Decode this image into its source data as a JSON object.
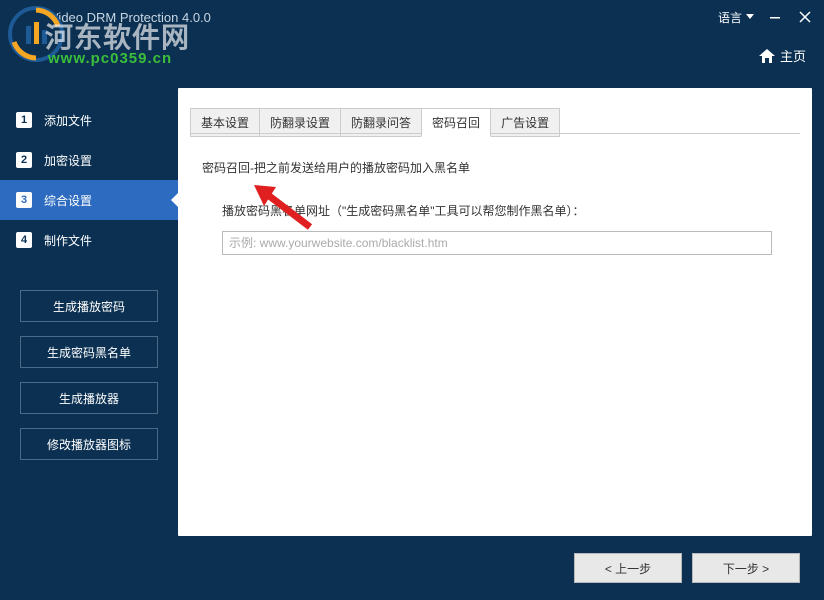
{
  "titlebar": {
    "app_title": "Video DRM Protection 4.0.0",
    "language_label": "语言"
  },
  "watermark": {
    "text": "河东软件网",
    "url": "www.pc0359.cn"
  },
  "breadcrumb": {
    "home": "主页"
  },
  "sidebar": {
    "steps": [
      {
        "num": "1",
        "label": "添加文件"
      },
      {
        "num": "2",
        "label": "加密设置"
      },
      {
        "num": "3",
        "label": "综合设置"
      },
      {
        "num": "4",
        "label": "制作文件"
      }
    ],
    "buttons": {
      "gen_password": "生成播放密码",
      "gen_blacklist": "生成密码黑名单",
      "gen_player": "生成播放器",
      "edit_player_icon": "修改播放器图标"
    }
  },
  "tabs": {
    "basic": "基本设置",
    "anti_record": "防翻录设置",
    "anti_record_qa": "防翻录问答",
    "password_recall": "密码召回",
    "ad_settings": "广告设置"
  },
  "panel": {
    "description": "密码召回-把之前发送给用户的播放密码加入黑名单",
    "field_label": "播放密码黑名单网址（\"生成密码黑名单\"工具可以帮您制作黑名单）：",
    "placeholder": "示例: www.yourwebsite.com/blacklist.htm"
  },
  "footer": {
    "prev": "< 上一步",
    "next": "下一步 >"
  }
}
